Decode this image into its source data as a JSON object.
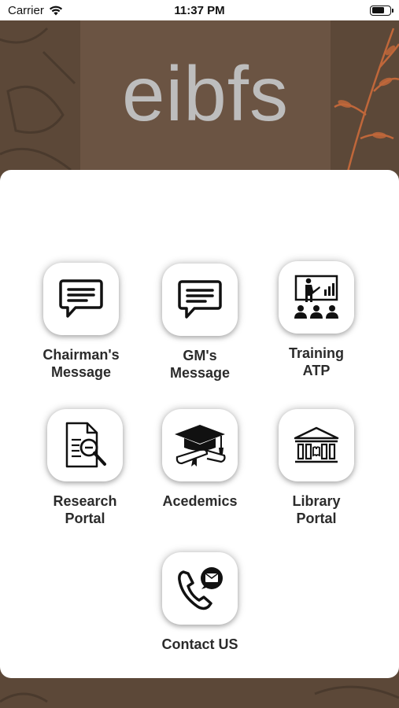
{
  "status_bar": {
    "carrier": "Carrier",
    "time": "11:37 PM"
  },
  "header": {
    "logo_text": "eibfs",
    "background_color": "#5c4838",
    "accent_color": "#c0673a"
  },
  "menu": {
    "items": [
      {
        "label": "Chairman's\nMessage",
        "icon": "chat-message-icon"
      },
      {
        "label": "GM's\nMessage",
        "icon": "chat-message-icon"
      },
      {
        "label": "Training\nATP",
        "icon": "presentation-training-icon"
      },
      {
        "label": "Research\nPortal",
        "icon": "document-search-icon"
      },
      {
        "label": "Acedemics",
        "icon": "graduation-cap-icon"
      },
      {
        "label": "Library\nPortal",
        "icon": "library-building-icon"
      },
      {
        "label": "Contact US",
        "icon": "phone-mail-icon"
      }
    ]
  }
}
